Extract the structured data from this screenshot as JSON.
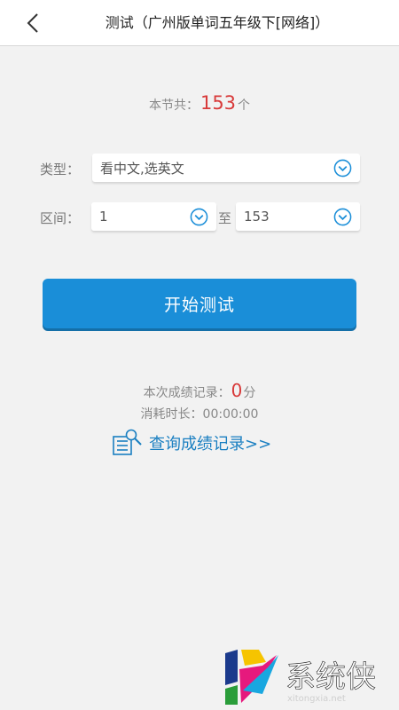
{
  "header": {
    "title": "测试（广州版单词五年级下[网络]）",
    "back_icon": "chevron-left-icon"
  },
  "summary": {
    "total_prefix": "本节共：",
    "total_count": "153",
    "total_suffix": "个"
  },
  "form": {
    "type_label": "类型：",
    "type_value": "看中文,选英文",
    "range_label": "区间：",
    "range_from": "1",
    "range_to_label": "至",
    "range_to": "153",
    "dropdown_icon": "chevron-down-circle-icon"
  },
  "actions": {
    "start_label": "开始测试"
  },
  "record": {
    "score_label": "本次成绩记录：",
    "score_value": "0",
    "score_unit": "分",
    "time_label": "消耗时长：",
    "time_value": "00:00:00",
    "query_label": "查询成绩记录>>",
    "query_icon": "search-list-icon"
  },
  "watermark": {
    "text": "系统侠",
    "url": "xitongxia.net"
  },
  "colors": {
    "accent": "#1a8ed8",
    "link": "#1a7fc1",
    "highlight": "#d83a3a",
    "background": "#f2f2f2"
  }
}
